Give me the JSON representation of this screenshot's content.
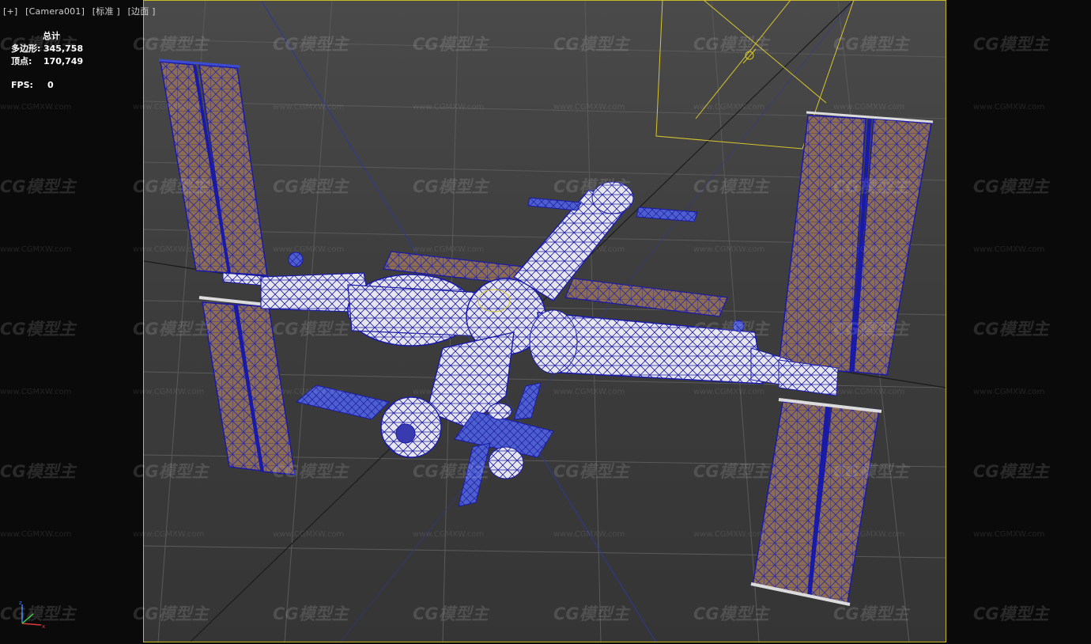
{
  "viewport": {
    "labels": [
      "[+]",
      "[Camera001]",
      "[标准 ]",
      "[边面 ]"
    ]
  },
  "stats": {
    "header": "总计",
    "polygons_label": "多边形:",
    "polygons_value": "345,758",
    "vertices_label": "顶点:",
    "vertices_value": "170,749",
    "fps_label": "FPS:",
    "fps_value": "0"
  },
  "watermark": {
    "logo_text": "CG模型主",
    "url_text": "www.CGMXW.com"
  },
  "colors": {
    "frame": "#c9b72a",
    "wire": "#1a1aa8",
    "panel": "#8a6a4e",
    "module": "#e8e8ec",
    "background": "#3f3f3f"
  }
}
